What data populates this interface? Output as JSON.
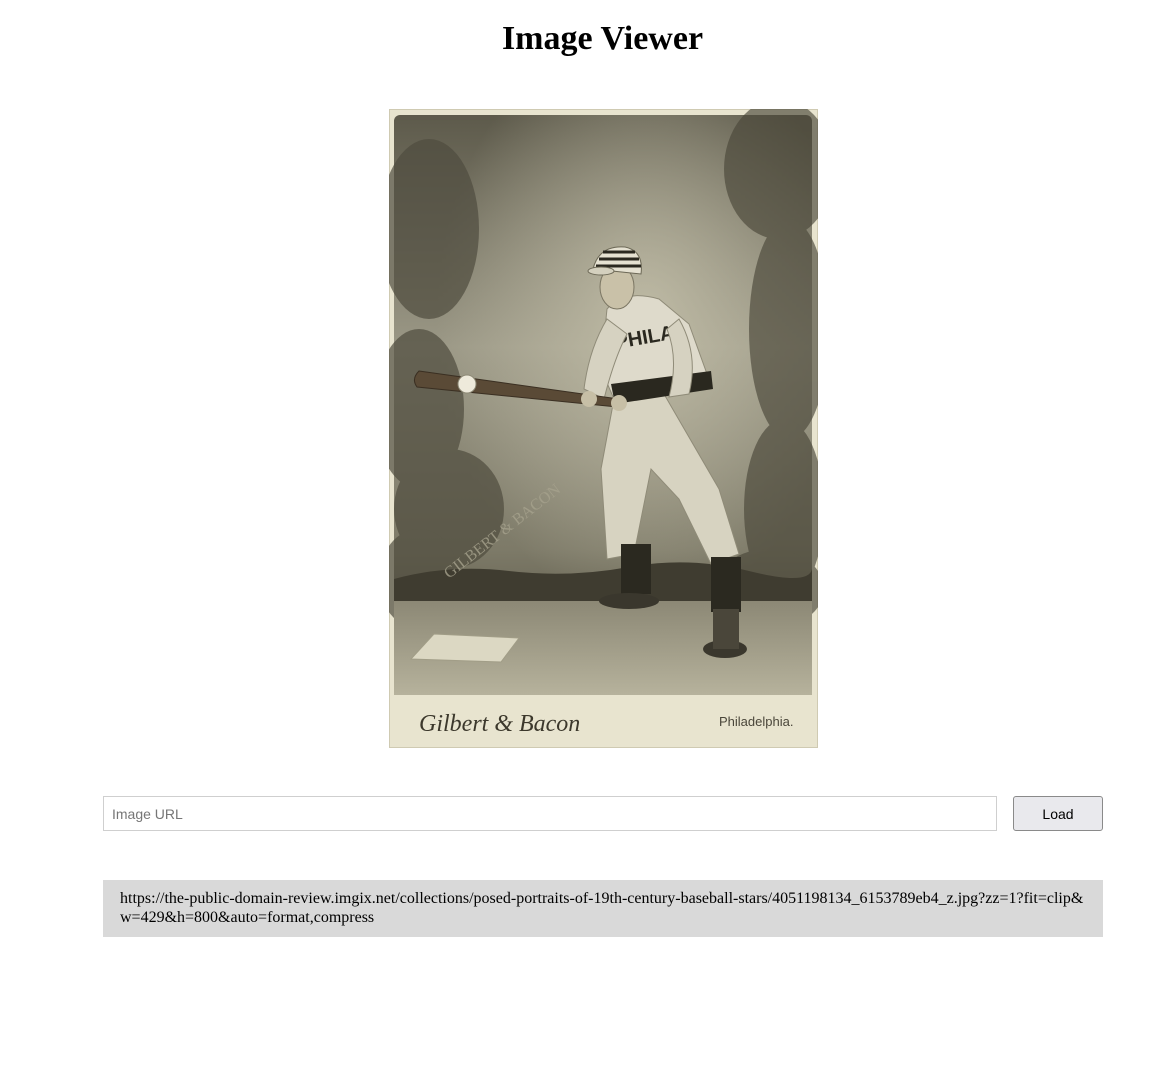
{
  "header": {
    "title": "Image Viewer"
  },
  "image": {
    "alt": "Posed portrait of a 19th-century baseball player in a PHILA uniform holding a bat",
    "caption_left": "Gilbert & Bacon",
    "caption_right": "Philadelphia.",
    "jersey_text": "PHILA"
  },
  "form": {
    "url_placeholder": "Image URL",
    "url_value": "",
    "load_label": "Load"
  },
  "current_url": {
    "text": "https://the-public-domain-review.imgix.net/collections/posed-portraits-of-19th-century-baseball-stars/4051198134_6153789eb4_z.jpg?zz=1?fit=clip&w=429&h=800&auto=format,compress"
  },
  "colors": {
    "url_box_bg": "#d9d9d9",
    "button_bg": "#e9e9ed",
    "photo_sepia": "#6e6a58",
    "card_mount": "#e8e4cf"
  }
}
